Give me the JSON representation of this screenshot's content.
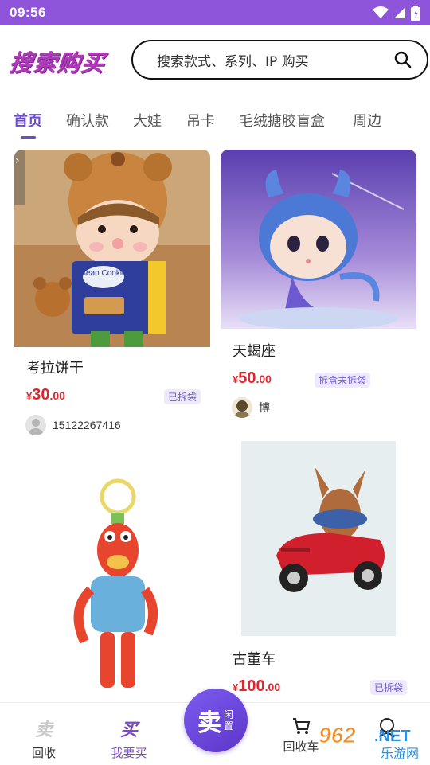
{
  "status_bar": {
    "time": "09:56"
  },
  "header": {
    "logo_text": "搜索购买",
    "search_placeholder": "搜索款式、系列、IP 购买"
  },
  "tabs": [
    {
      "label": "首页",
      "active": true
    },
    {
      "label": "确认款"
    },
    {
      "label": "大娃"
    },
    {
      "label": "吊卡"
    },
    {
      "label": "毛绒搪胶盲盒"
    },
    {
      "label": "周边"
    }
  ],
  "products": [
    {
      "title": "考拉饼干",
      "price_yen": "¥",
      "price_int": "30",
      "price_dec": ".00",
      "badge": "已拆袋",
      "seller": "15122267416",
      "image_text": "Bean Cookie"
    },
    {
      "title": "天蝎座",
      "price_yen": "¥",
      "price_int": "50",
      "price_dec": ".00",
      "badge": "拆盒未拆袋",
      "seller": "博"
    },
    {
      "title": "",
      "price_yen": "",
      "price_int": "",
      "price_dec": "",
      "badge": "",
      "seller": ""
    },
    {
      "title": "古董车",
      "price_yen": "¥",
      "price_int": "100",
      "price_dec": ".00",
      "badge": "已拆袋",
      "seller": ""
    }
  ],
  "bottom_nav": [
    {
      "label": "回收",
      "icon_text": "卖"
    },
    {
      "label": "我要买",
      "icon_text": "买",
      "active": true
    },
    {
      "label": "回收车"
    }
  ],
  "sell_button": {
    "main": "卖",
    "sub": "闲置"
  },
  "watermark": {
    "brand": "962",
    "site": "乐游网",
    "suffix": ".NET"
  },
  "colors": {
    "status_bar": "#8e54d9",
    "accent": "#6c4bd1",
    "price": "#e0262c",
    "logo": "#b03ab8"
  }
}
